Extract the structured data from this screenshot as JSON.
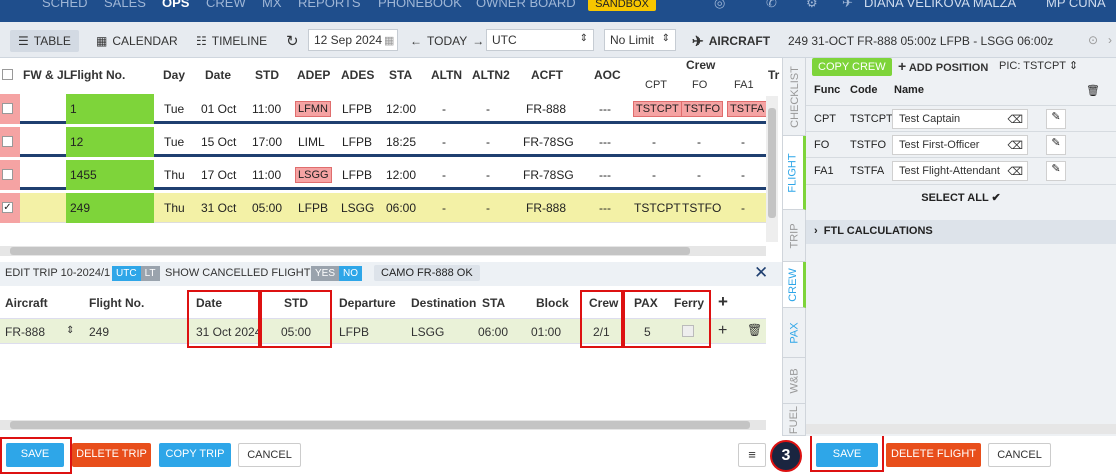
{
  "nav": {
    "items": [
      "SCHED",
      "SALES",
      "OPS",
      "CREW",
      "MX",
      "REPORTS",
      "PHONEBOOK",
      "OWNER BOARD"
    ],
    "sandbox": "SANDBOX",
    "user": "DIANA VELIKOVA MALZA",
    "user2": "MP CUNA"
  },
  "toolbar": {
    "table": "TABLE",
    "calendar": "CALENDAR",
    "timeline": "TIMELINE",
    "date": "12 Sep 2024",
    "today": "TODAY",
    "timezone": "UTC",
    "limit": "No Limit",
    "aircraft": "AIRCRAFT"
  },
  "flights": {
    "columns": [
      "FW & JL",
      "Flight No.",
      "Day",
      "Date",
      "STD",
      "ADEP",
      "ADES",
      "STA",
      "ALTN",
      "ALTN2",
      "ACFT",
      "AOC"
    ],
    "crew_header": "Crew",
    "crew_sub": [
      "CPT",
      "FO",
      "FA1"
    ],
    "tr_header": "Tr",
    "rows": [
      {
        "flight": "1",
        "day": "Tue",
        "date": "01 Oct",
        "std": "11:00",
        "adep": "LFMN",
        "ades": "LFPB",
        "sta": "12:00",
        "altn": "-",
        "altn2": "-",
        "acft": "FR-888",
        "aoc": "---",
        "cpt": "TSTCPT",
        "fo": "TSTFO",
        "fa1": "TSTFA"
      },
      {
        "flight": "12",
        "day": "Tue",
        "date": "15 Oct",
        "std": "17:00",
        "adep": "LIML",
        "ades": "LFPB",
        "sta": "18:25",
        "altn": "-",
        "altn2": "-",
        "acft": "FR-78SG",
        "aoc": "---",
        "cpt": "-",
        "fo": "-",
        "fa1": "-"
      },
      {
        "flight": "1455",
        "day": "Thu",
        "date": "17 Oct",
        "std": "11:00",
        "adep": "LSGG",
        "ades": "LFPB",
        "sta": "12:00",
        "altn": "-",
        "altn2": "-",
        "acft": "FR-78SG",
        "aoc": "---",
        "cpt": "-",
        "fo": "-",
        "fa1": "-"
      },
      {
        "flight": "249",
        "day": "Thu",
        "date": "31 Oct",
        "std": "05:00",
        "adep": "LFPB",
        "ades": "LSGG",
        "sta": "06:00",
        "altn": "-",
        "altn2": "-",
        "acft": "FR-888",
        "aoc": "---",
        "cpt": "TSTCPT",
        "fo": "TSTFO",
        "fa1": "-"
      }
    ]
  },
  "edit": {
    "title": "EDIT TRIP 10-2024/1",
    "utc": "UTC",
    "lt": "LT",
    "show_cancelled": "SHOW CANCELLED FLIGHTS",
    "yes": "YES",
    "no": "NO",
    "camo": "CAMO FR-888 OK",
    "columns": [
      "Aircraft",
      "Flight No.",
      "Date",
      "STD",
      "Departure",
      "Destination",
      "STA",
      "Block",
      "Crew",
      "PAX",
      "Ferry"
    ],
    "row": {
      "aircraft": "FR-888",
      "flight": "249",
      "date": "31 Oct 2024",
      "std": "05:00",
      "departure": "LFPB",
      "destination": "LSGG",
      "sta": "06:00",
      "block": "01:00",
      "crew": "2/1",
      "pax": "5"
    }
  },
  "footer": {
    "save": "SAVE",
    "delete_trip": "DELETE TRIP",
    "copy_trip": "COPY TRIP",
    "cancel": "CANCEL",
    "step": "3",
    "save2": "SAVE",
    "delete_flight": "DELETE FLIGHT",
    "cancel2": "CANCEL"
  },
  "vtabs": [
    "CHECKLIST",
    "FLIGHT",
    "TRIP",
    "CREW",
    "PAX",
    "W&B",
    "FUEL"
  ],
  "right": {
    "header": "249 31-OCT FR-888 05:00z LFPB - LSGG 06:00z",
    "copy_crew": "COPY CREW",
    "add_position": "ADD POSITION",
    "pic": "PIC: TSTCPT",
    "cols": [
      "Func",
      "Code",
      "Name"
    ],
    "crew": [
      {
        "func": "CPT",
        "code": "TSTCPT",
        "name": "Test Captain"
      },
      {
        "func": "FO",
        "code": "TSTFO",
        "name": "Test First-Officer"
      },
      {
        "func": "FA1",
        "code": "TSTFA",
        "name": "Test Flight-Attendant"
      }
    ],
    "select_all": "SELECT ALL",
    "ftl": "FTL CALCULATIONS"
  }
}
